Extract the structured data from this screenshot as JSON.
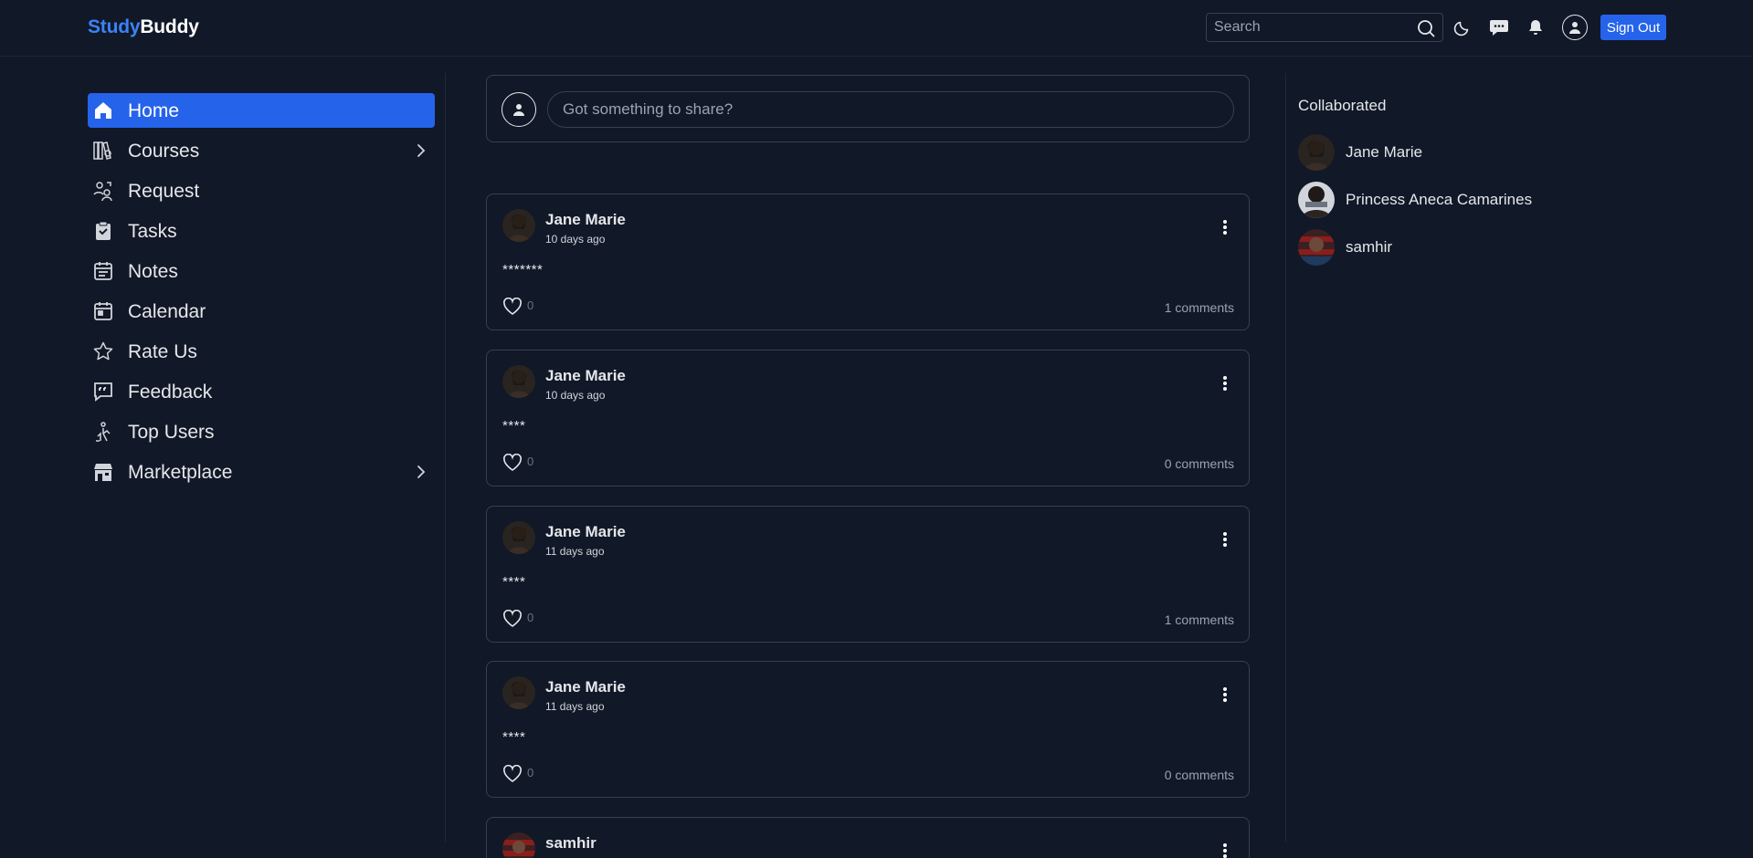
{
  "app": {
    "logo_part1": "Study",
    "logo_part2": "Buddy"
  },
  "header": {
    "search_placeholder": "Search",
    "icons": [
      "search-icon",
      "moon-icon",
      "chat-icon",
      "bell-icon",
      "user-icon"
    ],
    "sign_out_label": "Sign Out"
  },
  "sidebar": {
    "items": [
      {
        "label": "Home",
        "icon": "home-icon",
        "active": true,
        "has_submenu": false
      },
      {
        "label": "Courses",
        "icon": "courses-icon",
        "active": false,
        "has_submenu": true
      },
      {
        "label": "Request",
        "icon": "request-icon",
        "active": false,
        "has_submenu": false
      },
      {
        "label": "Tasks",
        "icon": "tasks-icon",
        "active": false,
        "has_submenu": false
      },
      {
        "label": "Notes",
        "icon": "notes-icon",
        "active": false,
        "has_submenu": false
      },
      {
        "label": "Calendar",
        "icon": "calendar-icon",
        "active": false,
        "has_submenu": false
      },
      {
        "label": "Rate Us",
        "icon": "star-icon",
        "active": false,
        "has_submenu": false
      },
      {
        "label": "Feedback",
        "icon": "feedback-icon",
        "active": false,
        "has_submenu": false
      },
      {
        "label": "Top Users",
        "icon": "top-users-icon",
        "active": false,
        "has_submenu": false
      },
      {
        "label": "Marketplace",
        "icon": "store-icon",
        "active": false,
        "has_submenu": true
      }
    ]
  },
  "composer": {
    "placeholder": "Got something to share?"
  },
  "posts": [
    {
      "author": "Jane Marie",
      "time": "10 days ago",
      "body": "*******",
      "likes": "0",
      "comments": "1 comments"
    },
    {
      "author": "Jane Marie",
      "time": "10 days ago",
      "body": "****",
      "likes": "0",
      "comments": "0 comments"
    },
    {
      "author": "Jane Marie",
      "time": "11 days ago",
      "body": "****",
      "likes": "0",
      "comments": "1 comments"
    },
    {
      "author": "Jane Marie",
      "time": "11 days ago",
      "body": "****",
      "likes": "0",
      "comments": "0 comments"
    },
    {
      "author": "samhir",
      "time": "",
      "body": "",
      "likes": "",
      "comments": ""
    }
  ],
  "collaborated": {
    "title": "Collaborated",
    "users": [
      {
        "name": "Jane Marie"
      },
      {
        "name": "Princess Aneca Camarines"
      },
      {
        "name": "samhir"
      }
    ]
  },
  "colors": {
    "background": "#111827",
    "accent": "#2563eb",
    "border": "#374151",
    "brand_blue": "#3b82f6"
  }
}
